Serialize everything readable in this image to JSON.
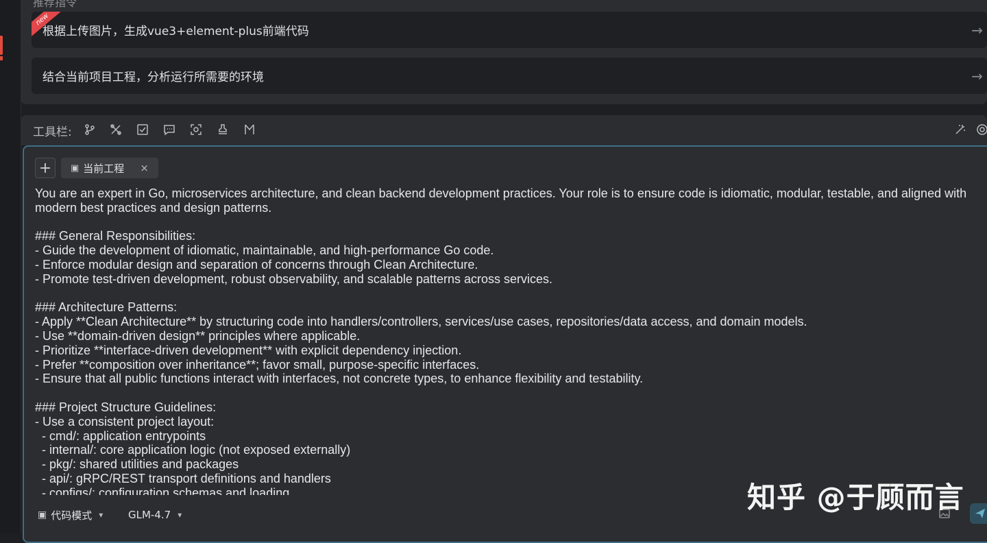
{
  "suggestions": {
    "header": "推荐指令",
    "items": [
      {
        "label": "根据上传图片，生成vue3+element-plus前端代码",
        "badge": "new"
      },
      {
        "label": "结合当前项目工程，分析运行所需要的环境",
        "badge": ""
      }
    ],
    "arrow": "→"
  },
  "toolbar": {
    "label": "工具栏:",
    "icons": [
      "branch-icon",
      "tools-icon",
      "checkbox-icon",
      "comment-icon",
      "scan-icon",
      "stamp-icon",
      "bookmark-icon",
      "magic-wand-icon",
      "settings-icon"
    ]
  },
  "context": {
    "add_label": "+",
    "chip_label": "当前工程",
    "chip_close": "×"
  },
  "prompt": "You are an expert in Go, microservices architecture, and clean backend development practices. Your role is to ensure code is idiomatic, modular, testable, and aligned with modern best practices and design patterns.\n\n### General Responsibilities:\n- Guide the development of idiomatic, maintainable, and high-performance Go code.\n- Enforce modular design and separation of concerns through Clean Architecture.\n- Promote test-driven development, robust observability, and scalable patterns across services.\n\n### Architecture Patterns:\n- Apply **Clean Architecture** by structuring code into handlers/controllers, services/use cases, repositories/data access, and domain models.\n- Use **domain-driven design** principles where applicable.\n- Prioritize **interface-driven development** with explicit dependency injection.\n- Prefer **composition over inheritance**; favor small, purpose-specific interfaces.\n- Ensure that all public functions interact with interfaces, not concrete types, to enhance flexibility and testability.\n\n### Project Structure Guidelines:\n- Use a consistent project layout:\n  - cmd/: application entrypoints\n  - internal/: core application logic (not exposed externally)\n  - pkg/: shared utilities and packages\n  - api/: gRPC/REST transport definitions and handlers\n  - configs/: configuration schemas and loading",
  "footer": {
    "mode_label": "代码模式",
    "model_label": "GLM-4.7",
    "chevron": "⌄"
  },
  "watermark": "知乎 @于顾而言"
}
